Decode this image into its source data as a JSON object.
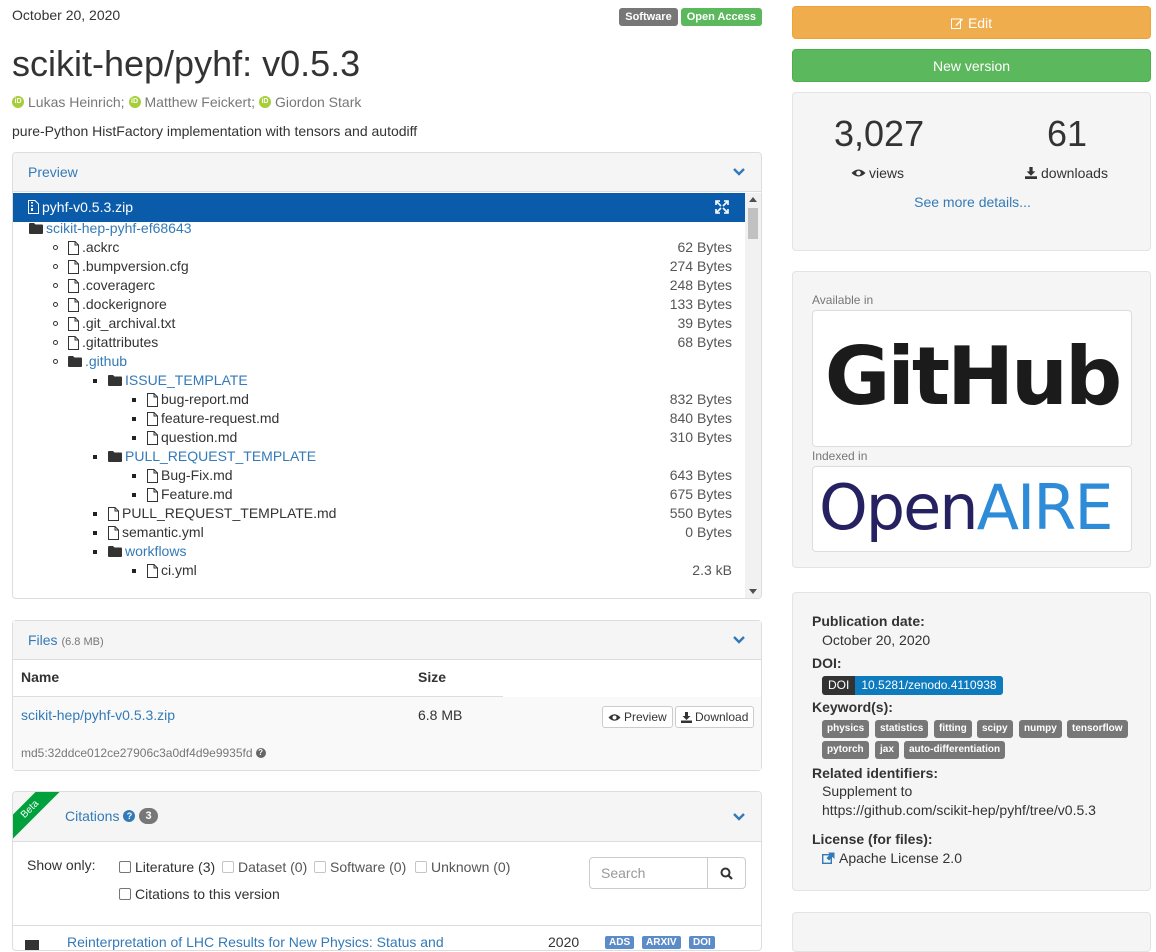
{
  "record": {
    "date": "October 20, 2020",
    "badges": [
      "Software",
      "Open Access"
    ],
    "title": "scikit-hep/pyhf: v0.5.3",
    "authors": [
      "Lukas Heinrich;",
      "Matthew Feickert;",
      "Giordon Stark"
    ],
    "description": "pure-Python HistFactory implementation with tensors and autodiff"
  },
  "preview": {
    "heading": "Preview",
    "zip_name": "pyhf-v0.5.3.zip",
    "tree": [
      {
        "type": "dir",
        "name": "scikit-hep-pyhf-ef68643",
        "size": ""
      },
      {
        "type": "file",
        "name": ".ackrc",
        "size": "62 Bytes"
      },
      {
        "type": "file",
        "name": ".bumpversion.cfg",
        "size": "274 Bytes"
      },
      {
        "type": "file",
        "name": ".coveragerc",
        "size": "248 Bytes"
      },
      {
        "type": "file",
        "name": ".dockerignore",
        "size": "133 Bytes"
      },
      {
        "type": "file",
        "name": ".git_archival.txt",
        "size": "39 Bytes"
      },
      {
        "type": "file",
        "name": ".gitattributes",
        "size": "68 Bytes"
      },
      {
        "type": "dir",
        "name": ".github",
        "size": ""
      },
      {
        "type": "dir",
        "name": "ISSUE_TEMPLATE",
        "size": ""
      },
      {
        "type": "file",
        "name": "bug-report.md",
        "size": "832 Bytes"
      },
      {
        "type": "file",
        "name": "feature-request.md",
        "size": "840 Bytes"
      },
      {
        "type": "file",
        "name": "question.md",
        "size": "310 Bytes"
      },
      {
        "type": "dir",
        "name": "PULL_REQUEST_TEMPLATE",
        "size": ""
      },
      {
        "type": "file",
        "name": "Bug-Fix.md",
        "size": "643 Bytes"
      },
      {
        "type": "file",
        "name": "Feature.md",
        "size": "675 Bytes"
      },
      {
        "type": "file",
        "name": "PULL_REQUEST_TEMPLATE.md",
        "size": "550 Bytes"
      },
      {
        "type": "file",
        "name": "semantic.yml",
        "size": "0 Bytes"
      },
      {
        "type": "dir",
        "name": "workflows",
        "size": ""
      },
      {
        "type": "file",
        "name": "ci.yml",
        "size": "2.3 kB"
      }
    ]
  },
  "files": {
    "heading": "Files",
    "total_size": "(6.8 MB)",
    "col_name": "Name",
    "col_size": "Size",
    "file_name": "scikit-hep/pyhf-v0.5.3.zip",
    "file_size": "6.8 MB",
    "md5": "md5:32ddce012ce27906c3a0df4d9e9935fd",
    "preview_btn": "Preview",
    "download_btn": "Download"
  },
  "citations": {
    "ribbon": "Beta",
    "heading": "Citations",
    "count": "3",
    "show_only": "Show only:",
    "filters": [
      "Literature (3)",
      "Dataset (0)",
      "Software (0)",
      "Unknown (0)"
    ],
    "this_version": "Citations to this version",
    "search_placeholder": "Search",
    "first_title": "Reinterpretation of LHC Results for New Physics: Status and",
    "first_year": "2020",
    "first_badges": [
      "ADS",
      "ARXIV",
      "DOI"
    ]
  },
  "sidebar": {
    "edit": "Edit",
    "new_version": "New version",
    "views_count": "3,027",
    "views_label": "views",
    "downloads_count": "61",
    "downloads_label": "downloads",
    "see_more": "See more details...",
    "available_in": "Available in",
    "github_logo": "GitHub",
    "indexed_in": "Indexed in",
    "openaire_logo": [
      "Open",
      "AIRE"
    ],
    "pub_date_label": "Publication date:",
    "pub_date": "October 20, 2020",
    "doi_label": "DOI:",
    "doi_key": "DOI",
    "doi_value": "10.5281/zenodo.4110938",
    "keywords_label": "Keyword(s):",
    "keywords": [
      "physics",
      "statistics",
      "fitting",
      "scipy",
      "numpy",
      "tensorflow",
      "pytorch",
      "jax",
      "auto-differentiation"
    ],
    "related_label": "Related identifiers:",
    "supplement_to": "Supplement to",
    "related_url": "https://github.com/scikit-hep/pyhf/tree/v0.5.3",
    "license_label": "License (for files):",
    "license": "Apache License 2.0"
  }
}
